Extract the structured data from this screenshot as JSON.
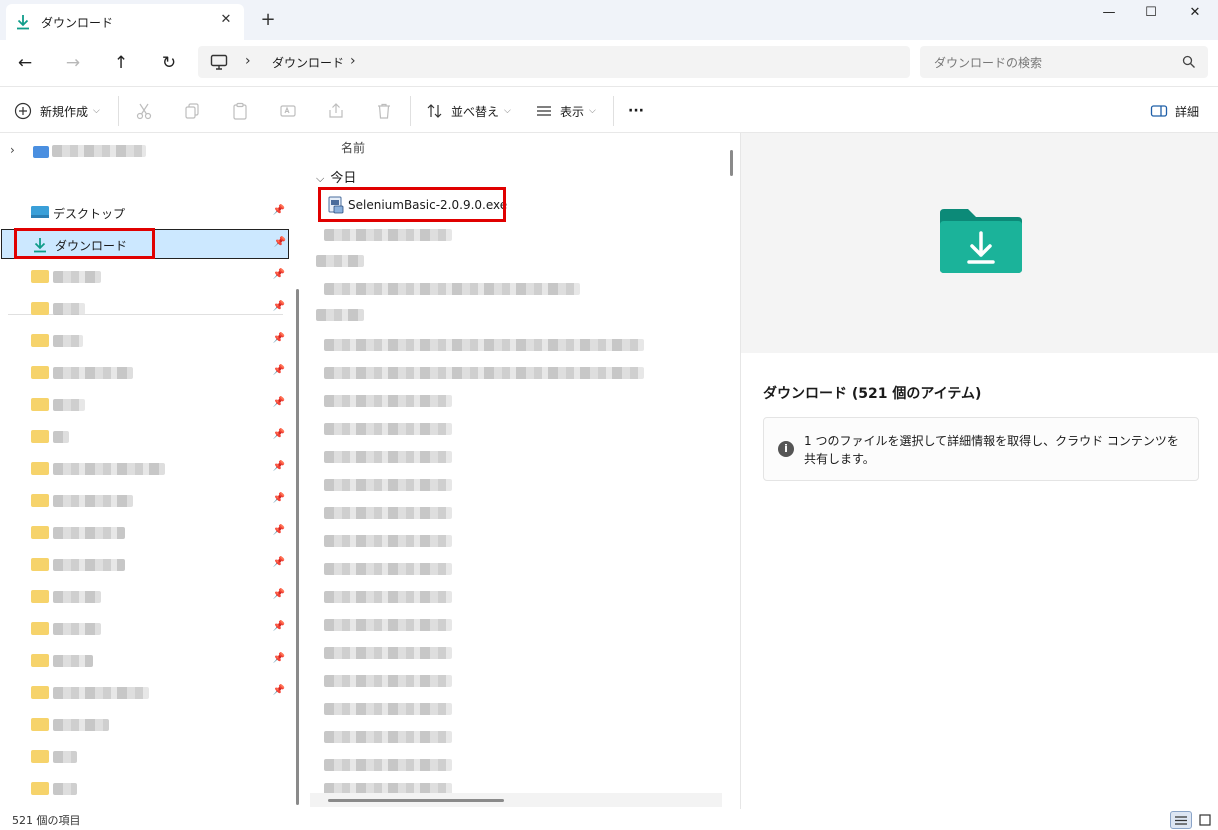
{
  "tab": {
    "title": "ダウンロード"
  },
  "address": {
    "crumb": "ダウンロード",
    "separator": "›"
  },
  "search": {
    "placeholder": "ダウンロードの検索"
  },
  "toolbar": {
    "new_label": "新規作成",
    "sort_label": "並べ替え",
    "view_label": "表示",
    "more_label": "···",
    "details_label": "詳細"
  },
  "nav": {
    "desktop_label": "デスクトップ",
    "downloads_label": "ダウンロード"
  },
  "filelist": {
    "column_name": "名前",
    "group_label": "今日",
    "highlighted_file": "SeleniumBasic-2.0.9.0.exe"
  },
  "details": {
    "title": "ダウンロード (521 個のアイテム)",
    "info_text": "1 つのファイルを選択して詳細情報を取得し、クラウド コンテンツを共有します。"
  },
  "status": {
    "item_count": "521 個の項目"
  },
  "colors": {
    "accent": "#0f9d8a",
    "highlight_red": "#e00000",
    "selection": "#cce8ff"
  }
}
